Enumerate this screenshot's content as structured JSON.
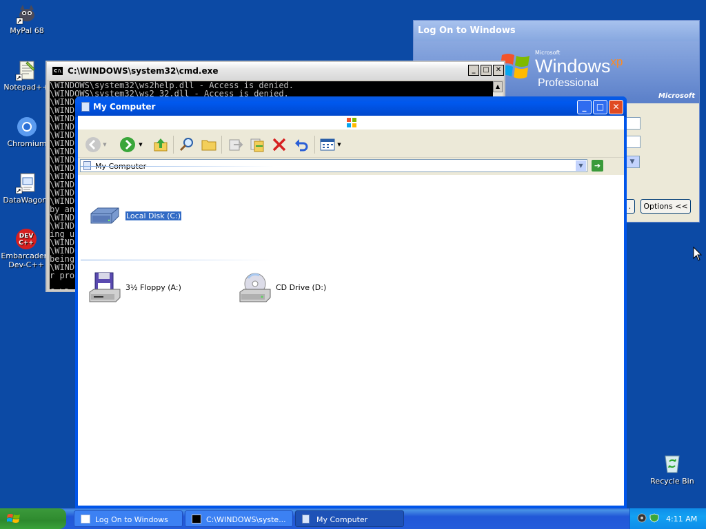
{
  "desktop": {
    "icons": [
      {
        "label": "MyPal 68"
      },
      {
        "label": "Notepad++"
      },
      {
        "label": "Chromium"
      },
      {
        "label": "DataWagon."
      },
      {
        "label": "Embarcadero Dev-C++"
      }
    ],
    "recycle_bin": {
      "label": "Recycle Bin"
    }
  },
  "logon_dialog": {
    "title": "Log On to Windows",
    "brand_small": "Microsoft",
    "brand_windows": "Windows",
    "brand_xp": "xp",
    "brand_edition": "Professional",
    "brand_microsoft": "Microsoft",
    "options_button": "Options <<",
    "partial_button": "."
  },
  "cmd_window": {
    "title": "C:\\WINDOWS\\system32\\cmd.exe",
    "lines": [
      "\\WINDOWS\\system32\\ws2help.dll - Access is denied.",
      "\\WINDOWS\\system32\\ws2_32.dll - Access is denied.",
      "\\WIND",
      "\\WIND",
      "\\WIND",
      "\\WIND",
      "\\WIND",
      "\\WIND",
      "\\WIND",
      "\\WIND",
      "\\WIND",
      "\\WIND",
      "\\WIND",
      "\\WIND",
      "\\WIND",
      "by an",
      "\\WIND",
      "\\WIND",
      "ing u",
      "\\WIND",
      "\\WIND",
      "being",
      "\\WIND",
      "r pro",
      "",
      "C:\\Do"
    ]
  },
  "my_computer": {
    "title": "My Computer",
    "address": "My Computer",
    "toolbar": {
      "back": "back-icon",
      "forward": "forward-icon",
      "up": "up-folder-icon",
      "search": "search-icon",
      "folders": "folders-icon",
      "move_to": "move-to-icon",
      "copy_to": "copy-to-icon",
      "delete": "delete-icon",
      "undo": "undo-icon",
      "views": "views-icon"
    },
    "drives": {
      "local_disk": "Local Disk (C:)",
      "floppy": "3½ Floppy (A:)",
      "cd_drive": "CD Drive (D:)"
    }
  },
  "taskbar": {
    "start": "start",
    "tasks": [
      {
        "label": "Log On to Windows"
      },
      {
        "label": "C:\\WINDOWS\\syste..."
      },
      {
        "label": "My Computer"
      }
    ],
    "clock": "4:11 AM"
  },
  "colors": {
    "desktop": "#0c4aa5",
    "titlebar": "#0058ee",
    "selection": "#316ac5",
    "taskbar": "#245ddb",
    "tray": "#13a1f2"
  }
}
